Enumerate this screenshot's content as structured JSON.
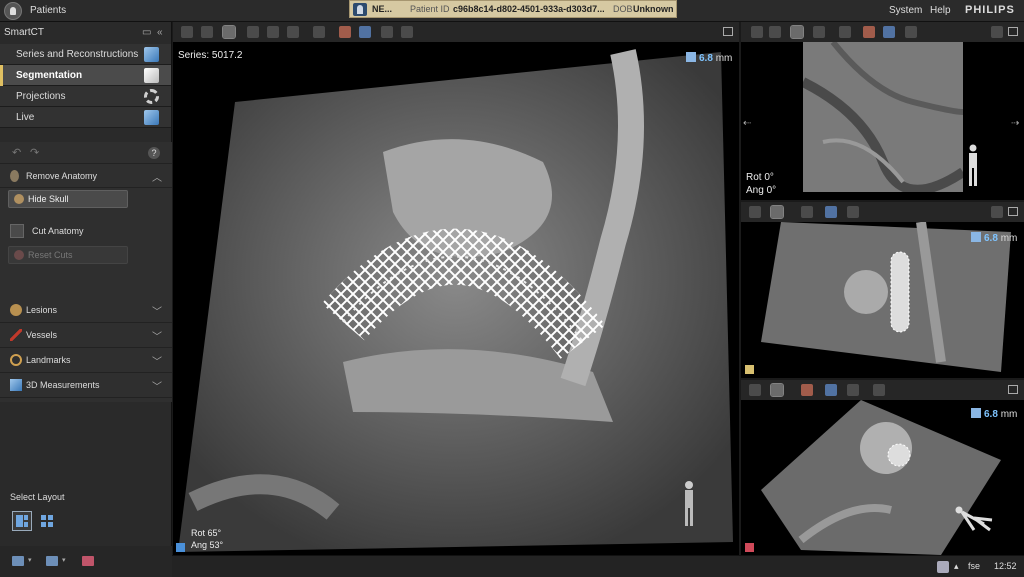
{
  "topbar": {
    "patients_label": "Patients",
    "patient_name": "NE...",
    "patient_id_label": "Patient ID",
    "patient_id_value": "c96b8c14-d802-4501-933a-d303d7...",
    "dob_label": "DOB",
    "dob_value": "Unknown",
    "system_label": "System",
    "help_label": "Help",
    "brand": "PHILIPS"
  },
  "leftpanel": {
    "title": "SmartCT",
    "nav": [
      {
        "label": "Series and Reconstructions",
        "icon": "cube-icon"
      },
      {
        "label": "Segmentation",
        "icon": "cube-icon",
        "active": true
      },
      {
        "label": "Projections",
        "icon": "rotation-icon"
      },
      {
        "label": "Live",
        "icon": "cube-icon"
      }
    ],
    "segmentation": {
      "remove_anatomy": "Remove Anatomy",
      "hide_skull": "Hide Skull",
      "cut_anatomy": "Cut Anatomy",
      "reset_cuts": "Reset Cuts",
      "sections": [
        "Lesions",
        "Vessels",
        "Landmarks",
        "3D Measurements"
      ]
    },
    "layout_label": "Select Layout"
  },
  "main_view": {
    "series": "Series: 5017.2",
    "slab_value": "6.8",
    "slab_unit": "mm",
    "rot": "Rot  65°",
    "ang": "Ang  53°",
    "marker_color": "#4a90d9"
  },
  "top_right_view": {
    "rot": "Rot   0°",
    "ang": "Ang   0°"
  },
  "mid_right_view": {
    "slab_value": "6.8",
    "slab_unit": "mm",
    "marker_color": "#d8c070"
  },
  "bottom_right_view": {
    "slab_value": "6.8",
    "slab_unit": "mm",
    "marker_color": "#d04a5a"
  },
  "statusbar": {
    "user": "fse",
    "time": "12:52"
  }
}
